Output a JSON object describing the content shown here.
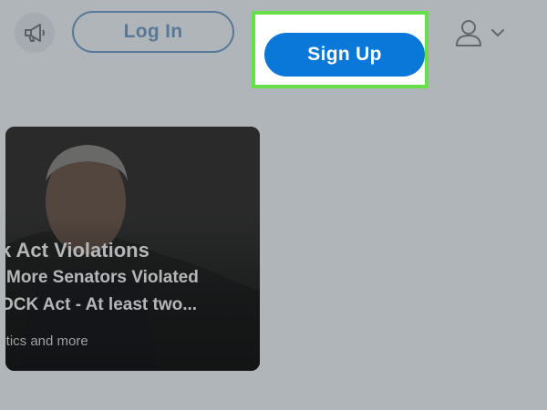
{
  "header": {
    "megaphone_icon": "megaphone-icon",
    "login_label": "Log In",
    "signup_label": "Sign Up",
    "account_icon": "user-icon",
    "chevron_icon": "chevron-down-icon"
  },
  "card": {
    "title": "k Act Violations",
    "snippet_line1": "More Senators Violated",
    "snippet_line2": "OCK Act - At least two...",
    "meta": "litics and more"
  },
  "colors": {
    "primary_blue": "#0a78d8",
    "outline_blue": "#1a5fa8",
    "highlight_green": "#67df4a",
    "overlay_gray": "#9ba2a8"
  }
}
